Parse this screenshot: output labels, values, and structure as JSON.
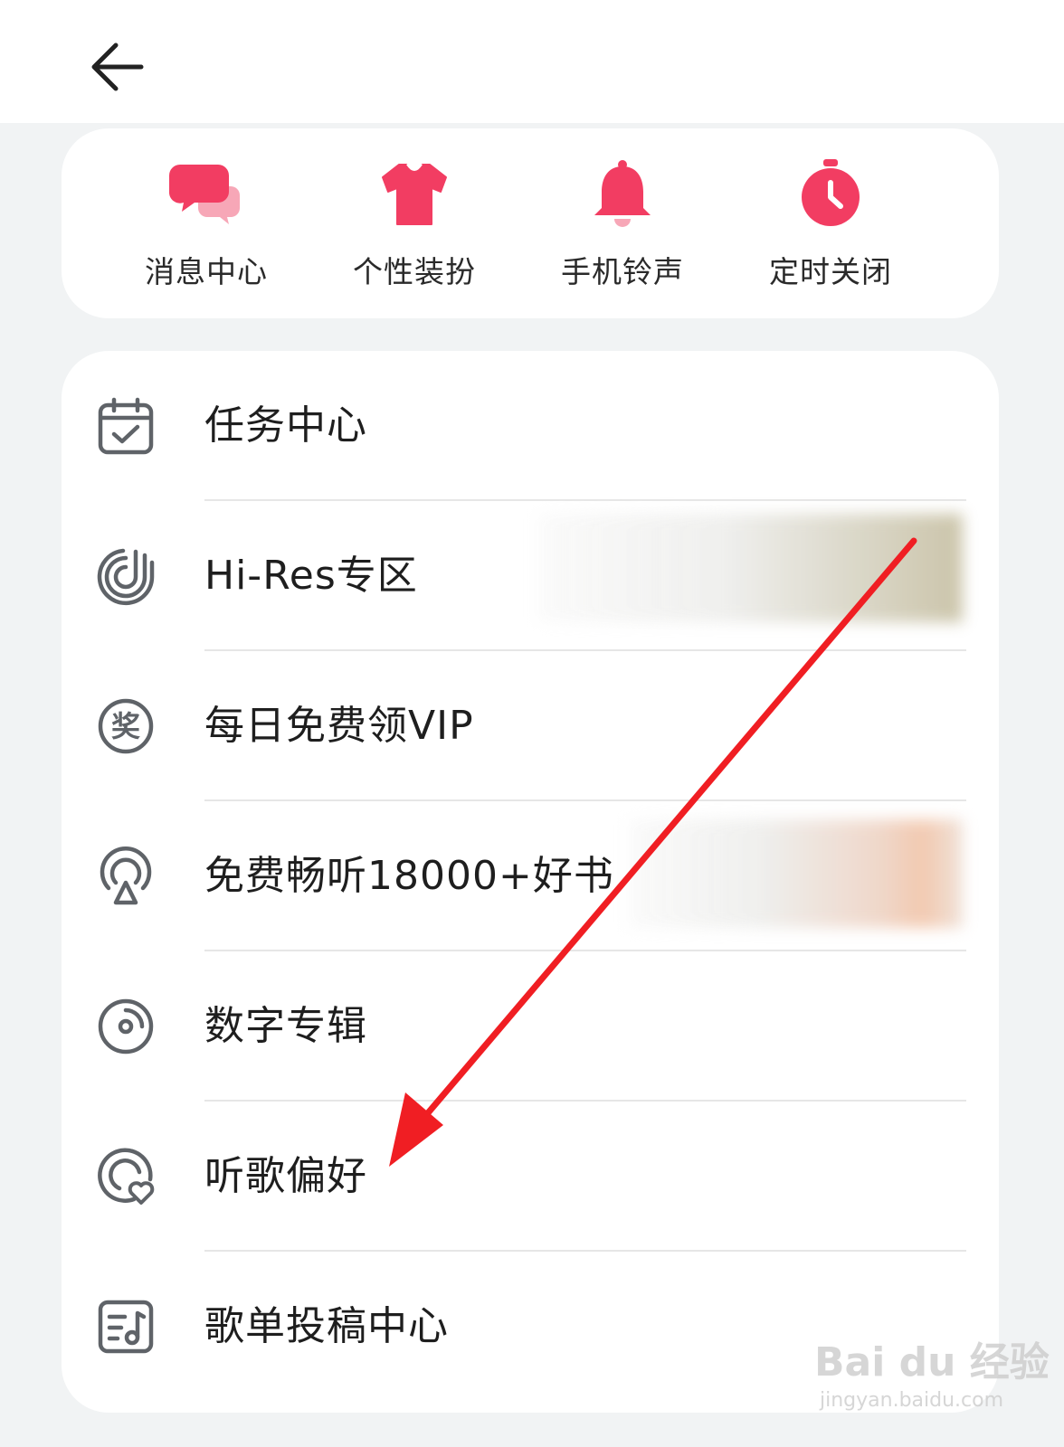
{
  "colors": {
    "accent": "#f23d62",
    "icon_gray": "#5f6368",
    "background": "#f1f3f4",
    "annotation_arrow": "#f01e23"
  },
  "header": {
    "back_icon": "arrow-left-icon"
  },
  "quick_actions": [
    {
      "label": "消息中心",
      "icon": "chat-bubbles-icon"
    },
    {
      "label": "个性装扮",
      "icon": "tshirt-icon"
    },
    {
      "label": "手机铃声",
      "icon": "bell-icon"
    },
    {
      "label": "定时关闭",
      "icon": "stopwatch-icon"
    }
  ],
  "menu": [
    {
      "label": "任务中心",
      "icon": "calendar-check-icon"
    },
    {
      "label": "Hi-Res专区",
      "icon": "hires-icon"
    },
    {
      "label": "每日免费领VIP",
      "icon": "award-icon"
    },
    {
      "label": "免费畅听18000+好书",
      "icon": "podcast-icon"
    },
    {
      "label": "数字专辑",
      "icon": "disc-icon"
    },
    {
      "label": "听歌偏好",
      "icon": "music-heart-icon"
    },
    {
      "label": "歌单投稿中心",
      "icon": "playlist-note-icon"
    }
  ],
  "award_glyph": "奖",
  "watermark": {
    "main": "Bai du 经验",
    "sub": "jingyan.baidu.com"
  }
}
